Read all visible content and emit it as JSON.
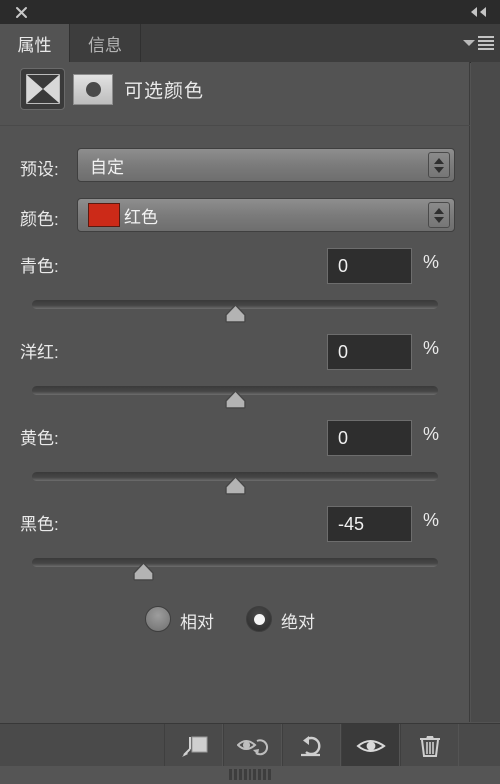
{
  "titlebar": {
    "close_icon": "close-icon",
    "collapse_icon": "double-chevron-left-icon"
  },
  "tabs": [
    {
      "label": "属性",
      "active": true
    },
    {
      "label": "信息",
      "active": false
    }
  ],
  "panel_menu": {
    "dropdown_icon": "chevron-down-icon",
    "menu_icon": "hamburger-menu-icon"
  },
  "adjustment": {
    "icon": "selective-color-icon",
    "mask_thumbnail": "layer-mask-thumbnail",
    "title": "可选颜色"
  },
  "preset": {
    "label": "预设:",
    "value": "自定"
  },
  "color": {
    "label": "颜色:",
    "value": "红色",
    "swatch_hex": "#cc2a18"
  },
  "sliders": [
    {
      "name": "cyan",
      "label": "青色:",
      "value": "0",
      "number": 0,
      "unit": "%"
    },
    {
      "name": "magenta",
      "label": "洋红:",
      "value": "0",
      "number": 0,
      "unit": "%"
    },
    {
      "name": "yellow",
      "label": "黄色:",
      "value": "0",
      "number": 0,
      "unit": "%"
    },
    {
      "name": "black",
      "label": "黑色:",
      "value": "-45",
      "number": -45,
      "unit": "%"
    }
  ],
  "slider_range": {
    "min": -100,
    "max": 100
  },
  "method": {
    "relative": {
      "label": "相对",
      "selected": false
    },
    "absolute": {
      "label": "绝对",
      "selected": true
    }
  },
  "toolbar": [
    {
      "name": "clip-to-layer-button",
      "icon": "clip-to-layer-icon",
      "active": false
    },
    {
      "name": "toggle-previous-state-button",
      "icon": "eye-previous-state-icon",
      "active": false
    },
    {
      "name": "reset-button",
      "icon": "reset-arrow-icon",
      "active": false
    },
    {
      "name": "toggle-visibility-button",
      "icon": "eye-icon",
      "active": true
    },
    {
      "name": "delete-button",
      "icon": "trash-icon",
      "active": false
    }
  ],
  "colors": {
    "panel_bg": "#535353",
    "titlebar_bg": "#2b2b2b",
    "tab_active_bg": "#535353",
    "tab_inactive_bg": "#3d3d3d",
    "toolbar_bg": "#4a4a4a",
    "input_bg": "#2e2e2e",
    "text": "#eaeaea"
  }
}
